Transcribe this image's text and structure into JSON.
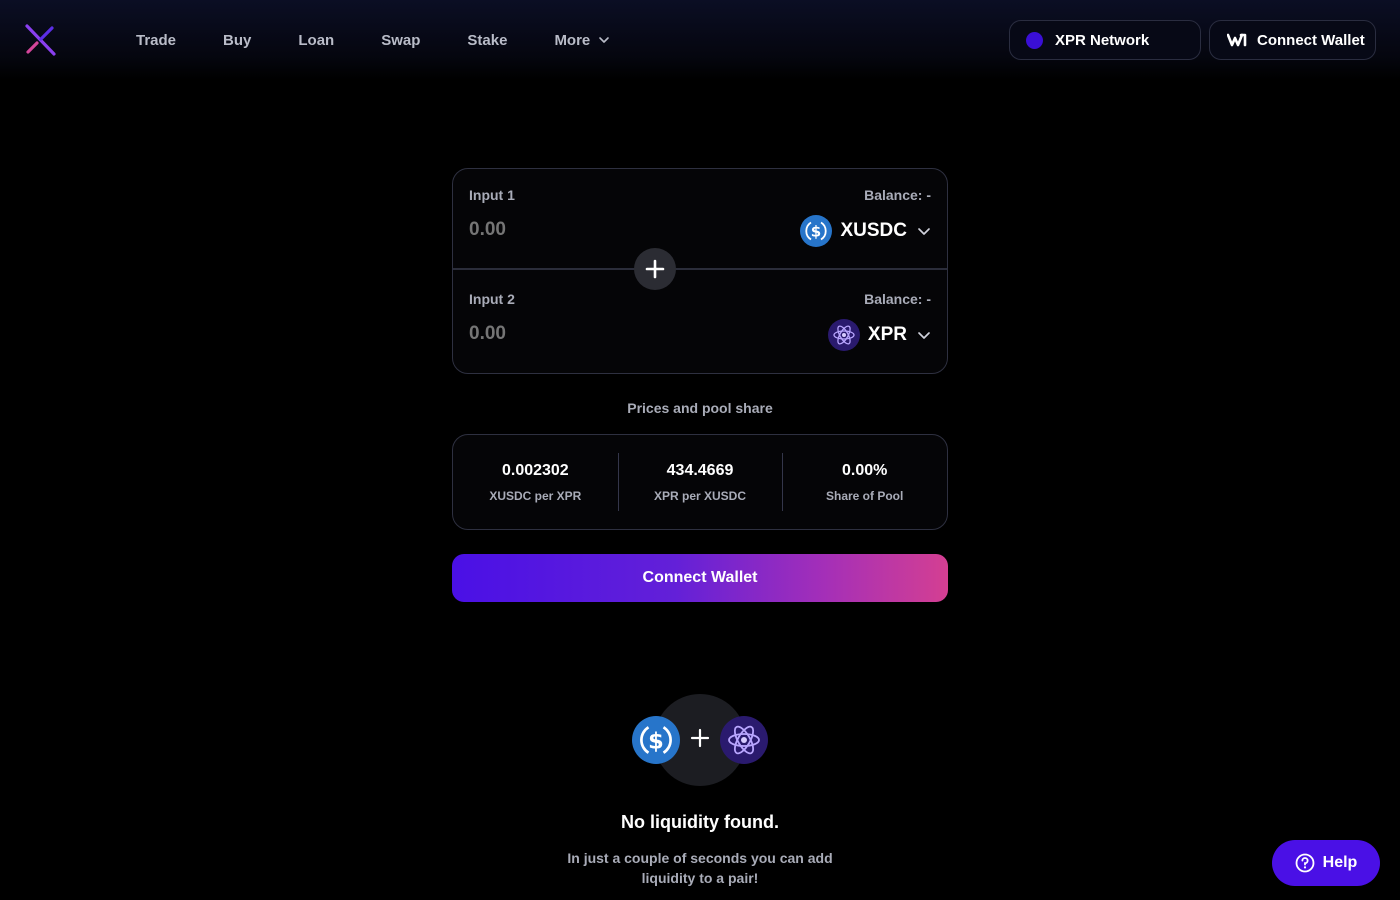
{
  "nav": {
    "items": [
      {
        "label": "Trade"
      },
      {
        "label": "Buy"
      },
      {
        "label": "Loan"
      },
      {
        "label": "Swap"
      },
      {
        "label": "Stake"
      },
      {
        "label": "More"
      }
    ]
  },
  "header": {
    "network_label": "XPR Network",
    "connect_label": "Connect Wallet"
  },
  "inputs": [
    {
      "label": "Input 1",
      "balance": "Balance: -",
      "value": "0.00",
      "token": "XUSDC",
      "token_icon": "usdc-icon"
    },
    {
      "label": "Input 2",
      "balance": "Balance: -",
      "value": "0.00",
      "token": "XPR",
      "token_icon": "xpr-icon"
    }
  ],
  "prices": {
    "title": "Prices and pool share",
    "cells": [
      {
        "value": "0.002302",
        "label": "XUSDC per XPR"
      },
      {
        "value": "434.4669",
        "label": "XPR per XUSDC"
      },
      {
        "value": "0.00%",
        "label": "Share of Pool"
      }
    ]
  },
  "main_button": {
    "label": "Connect Wallet"
  },
  "empty_state": {
    "title": "No liquidity found.",
    "subtitle": "In just a couple of seconds you can add liquidity to a pair!"
  },
  "help": {
    "label": "Help"
  },
  "colors": {
    "accent": "#4a10e6",
    "gradient_end": "#d43f92",
    "usdc_blue": "#2775ca",
    "xpr_purple": "#2a1a6e"
  }
}
